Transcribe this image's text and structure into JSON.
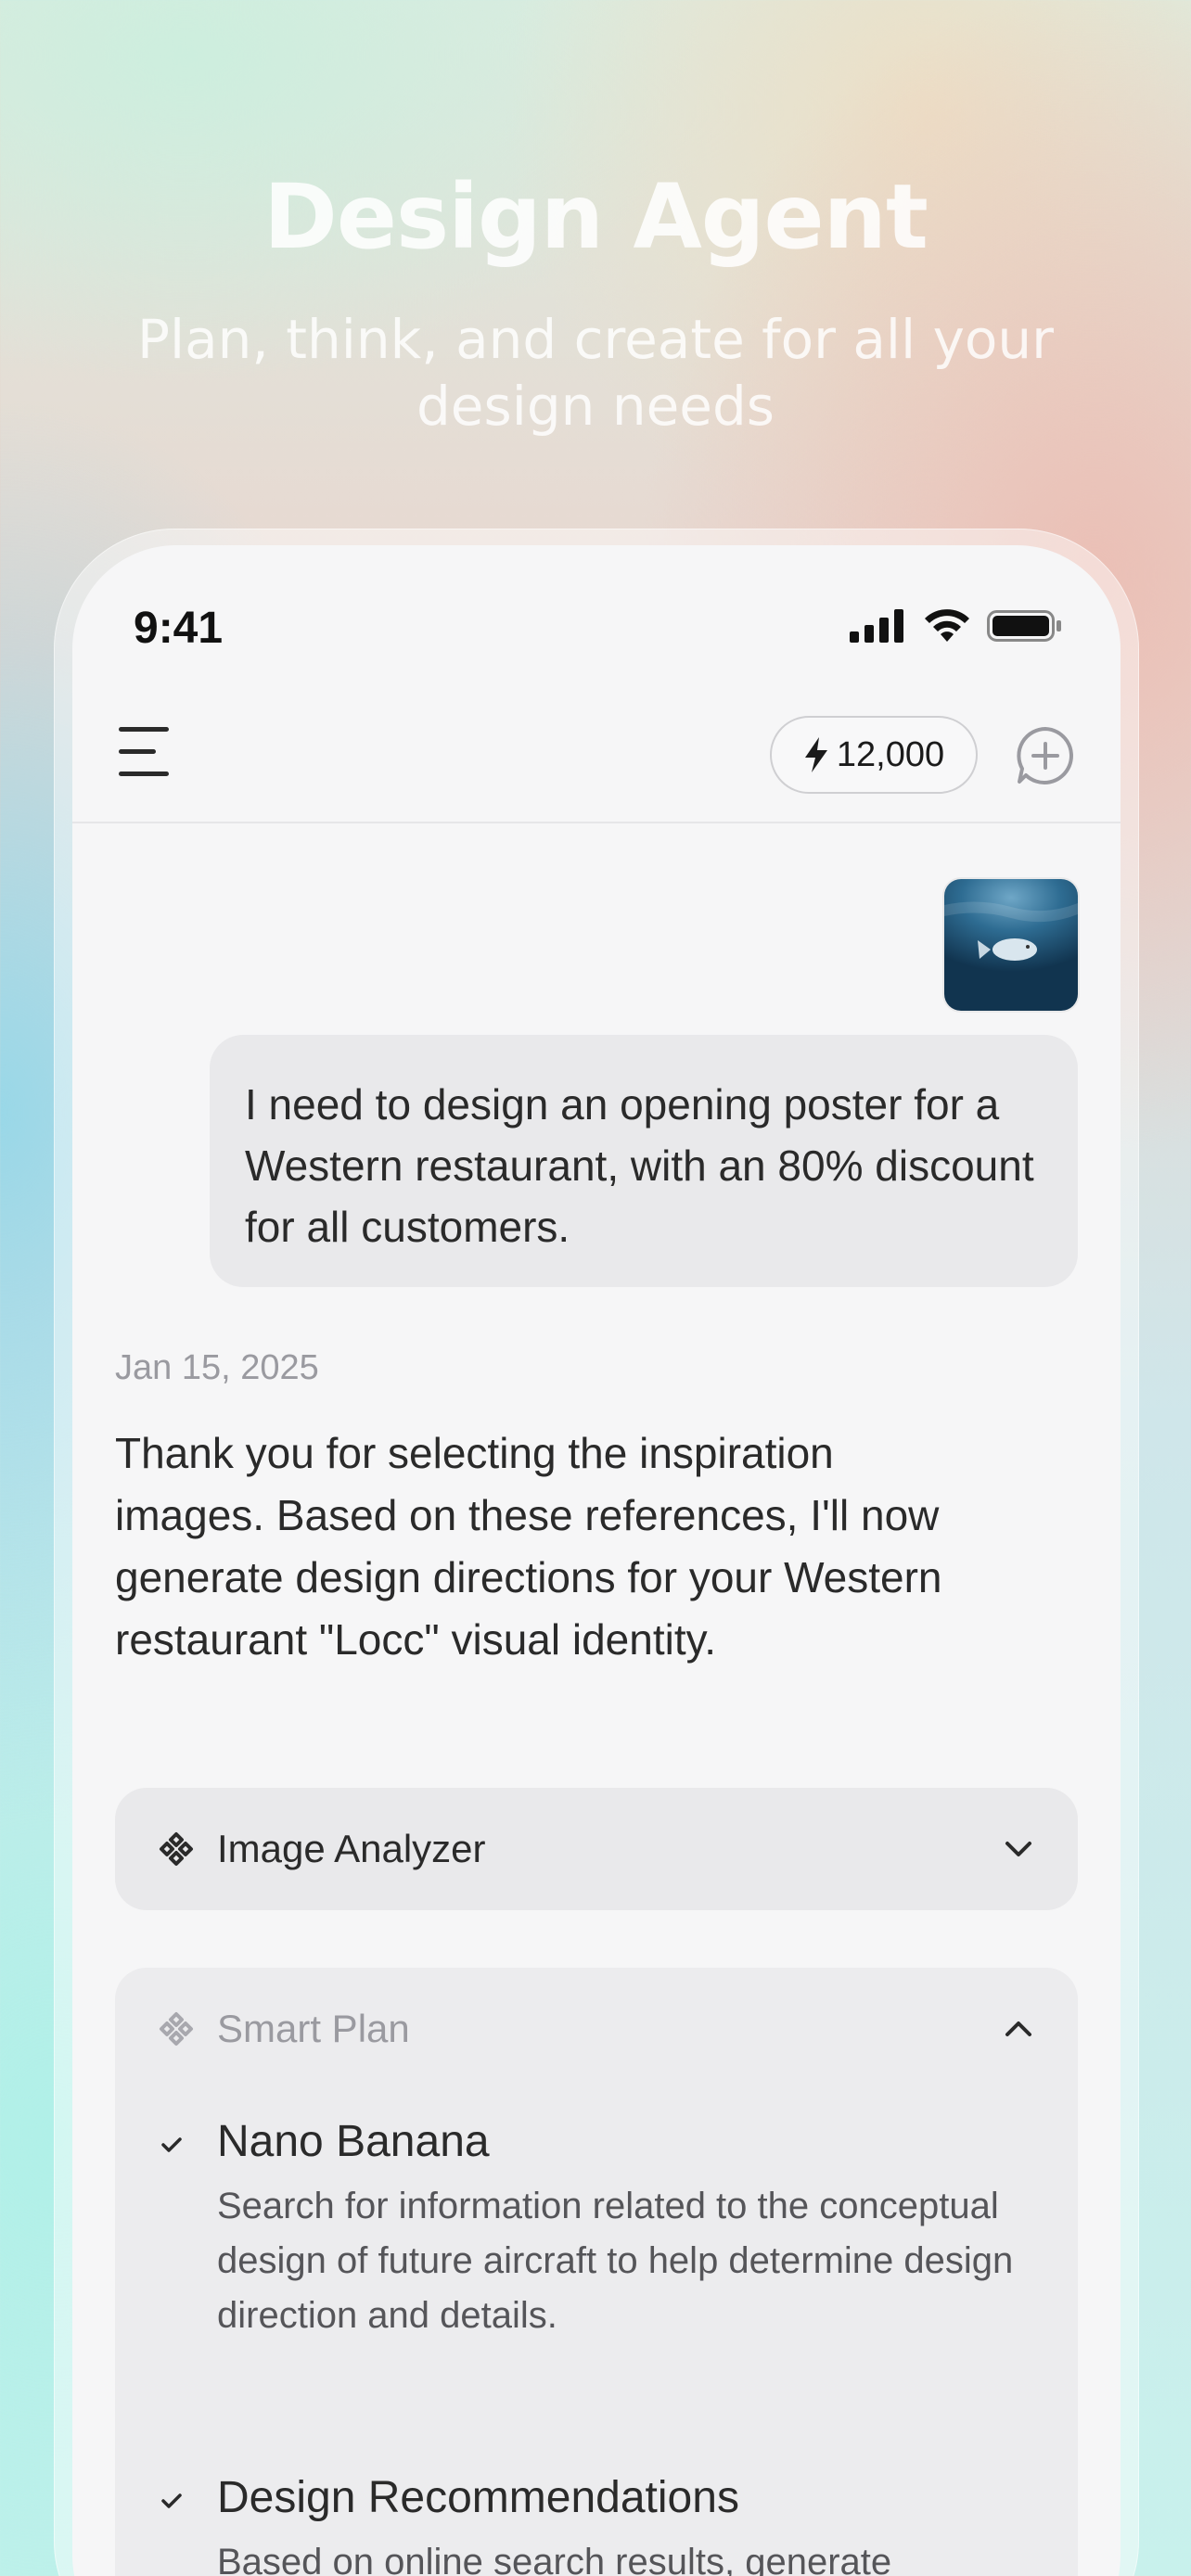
{
  "hero": {
    "title": "Design Agent",
    "subtitle": "Plan, think, and create for all your design needs"
  },
  "status_bar": {
    "time": "9:41",
    "icons": [
      "cellular-signal-icon",
      "wifi-icon",
      "battery-icon"
    ]
  },
  "nav": {
    "menu_icon": "hamburger-menu-icon",
    "credits": "12,000",
    "credits_icon": "lightning-bolt-icon",
    "new_chat_icon": "chat-plus-icon"
  },
  "conversation": {
    "attachment_icon": "fish-underwater-image",
    "user_message": "I need to design an opening poster for a Western restaurant, with an 80% discount for all customers.",
    "date": "Jan 15, 2025",
    "assistant_message": "Thank you for selecting the inspiration images. Based on these references, I'll now generate design directions for your Western restaurant \"Locc\" visual identity.",
    "tool_card": {
      "label": "Image Analyzer",
      "expanded": false
    },
    "plan_card": {
      "label": "Smart Plan",
      "expanded": true,
      "steps": [
        {
          "title": "Nano Banana",
          "description": "Search for information related to the conceptual design of future aircraft to help determine design direction and details."
        },
        {
          "title": "Design Recommendations",
          "description": "Based on online search results, generate"
        }
      ]
    }
  },
  "colors": {
    "text_primary": "#2a2a2a",
    "text_muted": "#9a9aa0",
    "bubble_bg": "#e9e9eb",
    "screen_bg": "#f6f6f7"
  }
}
